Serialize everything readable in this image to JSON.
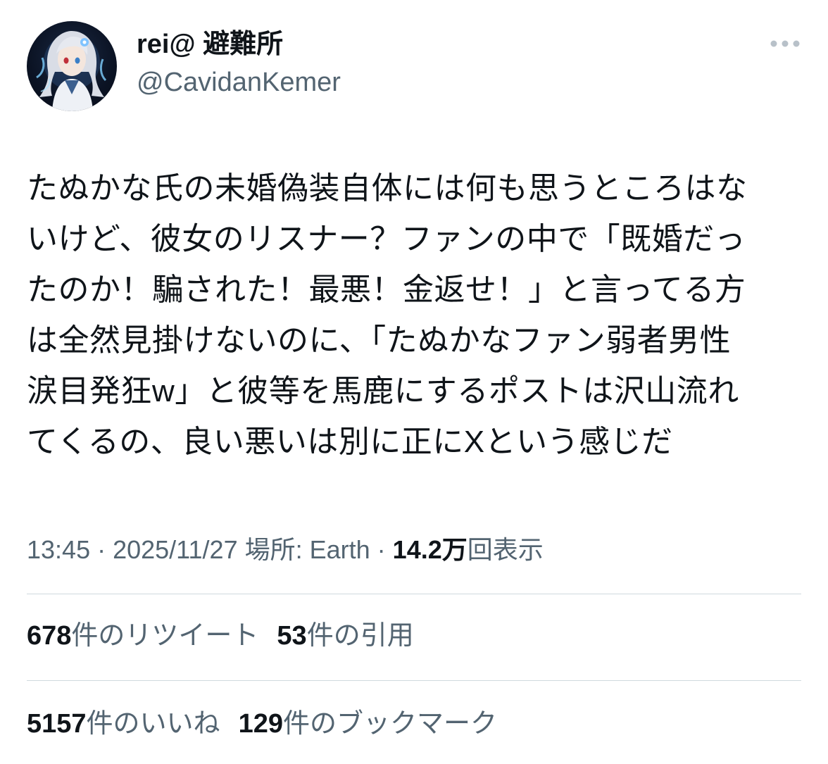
{
  "author": {
    "display_name": "rei@ 避難所",
    "handle": "@CavidanKemer",
    "avatar_icon": "anime-character-avatar"
  },
  "more_icon": "more-horizontal-icon",
  "tweet": {
    "lines": [
      "たぬかな氏の未婚偽装自体には何も思うところはな",
      "いけど、彼女のリスナー？ファンの中で「既婚だっ",
      "たのか！騙された！最悪！金返せ！」と言ってる方",
      "は全然見掛けないのに、「たぬかなファン弱者男性",
      "涙目発狂w」と彼等を馬鹿にするポストは沢山流れ",
      "てくるの、良い悪いは別に正にXという感じだ"
    ]
  },
  "meta": {
    "time": "13:45",
    "sep1": " · ",
    "date": "2025/11/27",
    "location": " 場所: Earth",
    "sep2": " · ",
    "views_count": "14.2万",
    "views_label": "回表示"
  },
  "stats": {
    "retweets": {
      "count": "678",
      "label": "件のリツイート"
    },
    "quotes": {
      "count": "53",
      "label": "件の引用"
    },
    "likes": {
      "count": "5157",
      "label": "件のいいね"
    },
    "bookmarks": {
      "count": "129",
      "label": "件のブックマーク"
    }
  },
  "colors": {
    "text_primary": "#0f1419",
    "text_secondary": "#536471",
    "divider": "#cfd9de",
    "background": "#ffffff"
  }
}
